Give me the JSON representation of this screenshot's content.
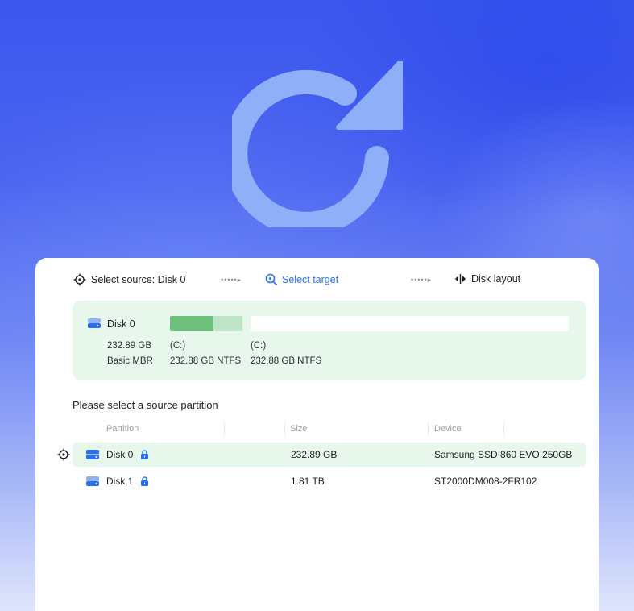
{
  "steps": {
    "source_label": "Select source: Disk 0",
    "target_label": "Select target",
    "layout_label": "Disk layout",
    "separator": "•••••▸"
  },
  "disk_card": {
    "name": "Disk 0",
    "capacity": "232.89 GB",
    "type": "Basic MBR",
    "used_fraction": 0.6,
    "partitions": [
      {
        "letter": "(C:)",
        "detail": "232.88 GB NTFS"
      },
      {
        "letter": "(C:)",
        "detail": "232.88 GB NTFS"
      }
    ]
  },
  "list": {
    "title": "Please select a source partition",
    "columns": {
      "partition": "Partition",
      "size": "Size",
      "device": "Device"
    },
    "rows": [
      {
        "name": "Disk 0",
        "size": "232.89 GB",
        "device": "Samsung SSD 860 EVO 250GB",
        "selected": true
      },
      {
        "name": "Disk 1",
        "size": "1.81 TB",
        "device": "ST2000DM008-2FR102",
        "selected": false
      }
    ]
  },
  "colors": {
    "accent": "#2b6ff2",
    "card_bg": "#e8f7ec",
    "bar_used": "#6cc07c",
    "bar_free": "#bfe5c8"
  },
  "icons": {
    "hero": "refresh-arrow-icon",
    "source": "crosshair-icon",
    "target": "magnifier-target-icon",
    "layout": "split-arrows-icon",
    "drive": "drive-icon",
    "lock": "lock-icon"
  }
}
